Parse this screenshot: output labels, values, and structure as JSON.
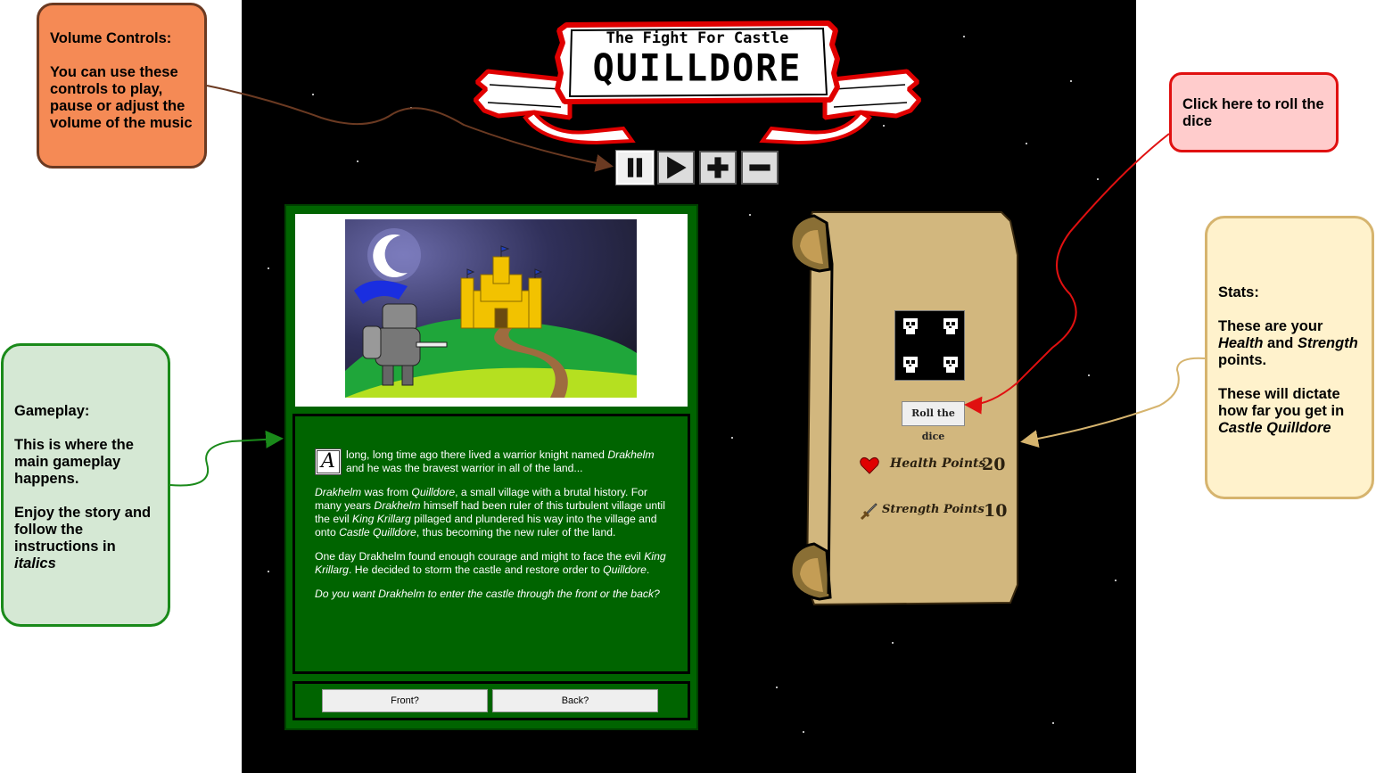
{
  "banner": {
    "line1": "The Fight For Castle",
    "line2": "QUILLDORE"
  },
  "volume_controls": {
    "buttons": [
      {
        "name": "pause",
        "icon": "pause-icon"
      },
      {
        "name": "play",
        "icon": "play-icon"
      },
      {
        "name": "volume-up",
        "icon": "plus-icon"
      },
      {
        "name": "volume-down",
        "icon": "minus-icon"
      }
    ]
  },
  "story": {
    "dropcap": "A",
    "p1_a": "long, long time ago there lived a warrior knight named ",
    "p1_em": "Drakhelm",
    "p1_b": " and he was the bravest warrior in all of the land...",
    "p2_em1": "Drakhelm",
    "p2_a": " was from ",
    "p2_em2": "Quilldore",
    "p2_b": ", a small village with a brutal history. For many years ",
    "p2_em3": "Drakhelm",
    "p2_c": " himself had been ruler of this turbulent village until the evil ",
    "p2_em4": "King Krillarg",
    "p2_d": " pillaged and plundered his way into the village and onto ",
    "p2_em5": "Castle Quilldore",
    "p2_e": ", thus becoming the new ruler of the land.",
    "p3_a": "One day Drakhelm found enough courage and might to face the evil ",
    "p3_em1": "King Krillarg",
    "p3_b": ". He decided to storm the castle and restore order to ",
    "p3_em2": "Quilldore",
    "p3_c": ".",
    "p4_em": "Do you want Drakhelm to enter the castle through the front or the back?"
  },
  "choices": {
    "front": "Front?",
    "back": "Back?"
  },
  "stats": {
    "roll_label": "Roll the dice",
    "dice_value": 4,
    "health_label": "Health Points",
    "health_value": "20",
    "strength_label": "Strength Points",
    "strength_value": "10"
  },
  "notes": {
    "volume": {
      "title": "Volume Controls:",
      "body": "You can use these controls to play, pause or adjust the volume of the music"
    },
    "roll": {
      "body": "Click here to roll the dice"
    },
    "stats": {
      "title": "Stats:",
      "body_a": "These are your ",
      "em1": "Health",
      "body_b": " and ",
      "em2": "Strength",
      "body_c": " points.",
      "body2_a": "These will dictate how far you get in ",
      "em3": "Castle Quilldore"
    },
    "gameplay": {
      "title": "Gameplay:",
      "body": "This is where the main gameplay happens.",
      "body2": "Enjoy the story and follow the instructions in ",
      "em": "italics"
    }
  },
  "colors": {
    "panel_green": "#006400",
    "parchment": "#d2b77e",
    "banner_red": "#e00000",
    "note_orange": "#f58a55",
    "note_pink": "#ffcccc",
    "note_yellow": "#fff2cc",
    "note_green": "#d5e8d4"
  }
}
